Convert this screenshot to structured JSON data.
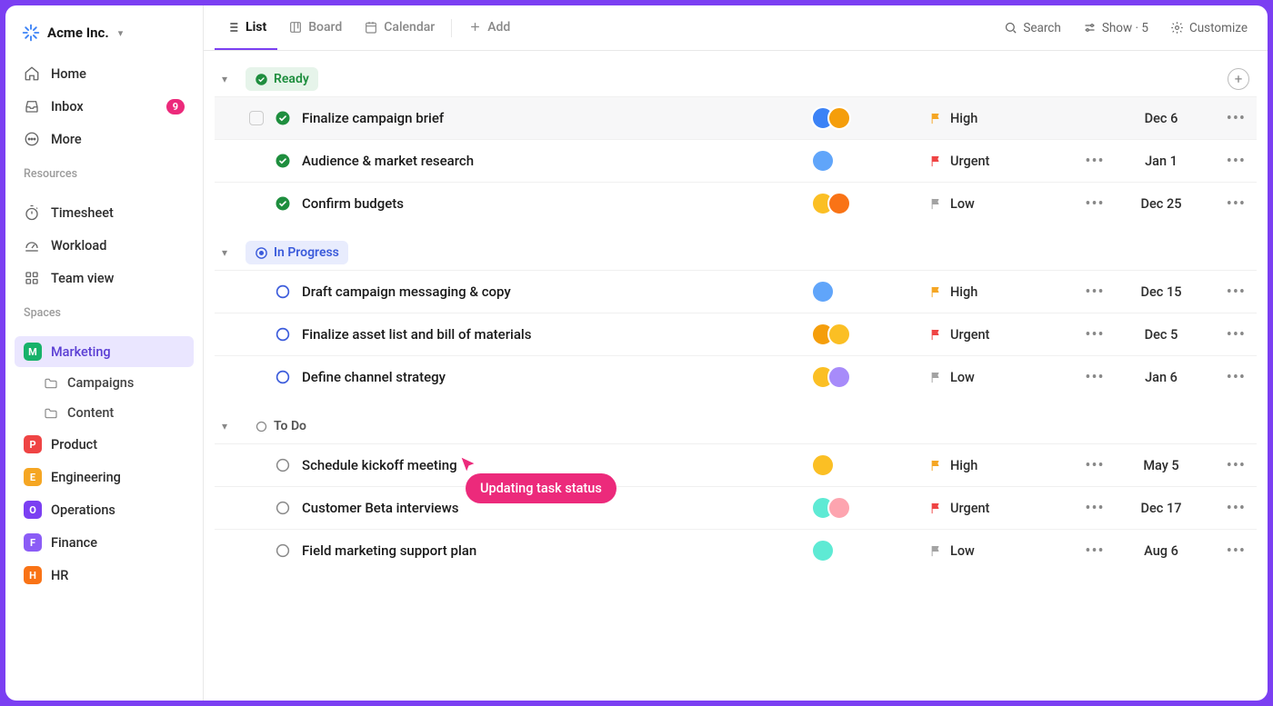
{
  "workspace": {
    "name": "Acme Inc."
  },
  "nav": {
    "home": "Home",
    "inbox": "Inbox",
    "inbox_count": "9",
    "more": "More"
  },
  "resources_label": "Resources",
  "resources": {
    "timesheet": "Timesheet",
    "workload": "Workload",
    "teamview": "Team view"
  },
  "spaces_label": "Spaces",
  "spaces": [
    {
      "letter": "M",
      "label": "Marketing",
      "color": "#17b26a",
      "active": true
    },
    {
      "letter": "P",
      "label": "Product",
      "color": "#ef4444"
    },
    {
      "letter": "E",
      "label": "Engineering",
      "color": "#f5a623"
    },
    {
      "letter": "O",
      "label": "Operations",
      "color": "#7b3ff2"
    },
    {
      "letter": "F",
      "label": "Finance",
      "color": "#8b5cf6"
    },
    {
      "letter": "H",
      "label": "HR",
      "color": "#f97316"
    }
  ],
  "folders": [
    "Campaigns",
    "Content"
  ],
  "tabs": {
    "list": "List",
    "board": "Board",
    "calendar": "Calendar",
    "add": "Add"
  },
  "toolbar": {
    "search": "Search",
    "show": "Show · 5",
    "customize": "Customize"
  },
  "tooltip": "Updating task status",
  "groups": [
    {
      "id": "ready",
      "label": "Ready",
      "add": true,
      "tasks": [
        {
          "name": "Finalize campaign brief",
          "status": "done",
          "assignees": [
            {
              "c": "#3b82f6"
            },
            {
              "c": "#f59e0b"
            }
          ],
          "prio": "High",
          "prio_c": "#f5a623",
          "date": "Dec 6",
          "sub": false,
          "hover": true,
          "check": true
        },
        {
          "name": "Audience & market research",
          "status": "done",
          "assignees": [
            {
              "c": "#60a5fa"
            }
          ],
          "prio": "Urgent",
          "prio_c": "#ef4444",
          "date": "Jan 1",
          "sub": true
        },
        {
          "name": "Confirm budgets",
          "status": "done",
          "assignees": [
            {
              "c": "#fbbf24"
            },
            {
              "c": "#f97316"
            }
          ],
          "prio": "Low",
          "prio_c": "#a3a3a3",
          "date": "Dec 25",
          "sub": true
        }
      ]
    },
    {
      "id": "inprog",
      "label": "In Progress",
      "tasks": [
        {
          "name": "Draft campaign messaging & copy",
          "status": "open-blue",
          "assignees": [
            {
              "c": "#60a5fa"
            }
          ],
          "prio": "High",
          "prio_c": "#f5a623",
          "date": "Dec 15",
          "sub": true
        },
        {
          "name": "Finalize asset list and bill of materials",
          "status": "open-blue",
          "assignees": [
            {
              "c": "#f59e0b"
            },
            {
              "c": "#fbbf24"
            }
          ],
          "prio": "Urgent",
          "prio_c": "#ef4444",
          "date": "Dec 5",
          "sub": true
        },
        {
          "name": "Define channel strategy",
          "status": "open-blue",
          "assignees": [
            {
              "c": "#fbbf24"
            },
            {
              "c": "#a78bfa"
            }
          ],
          "prio": "Low",
          "prio_c": "#a3a3a3",
          "date": "Jan 6",
          "sub": true
        }
      ]
    },
    {
      "id": "todo",
      "label": "To Do",
      "tasks": [
        {
          "name": "Schedule kickoff meeting",
          "status": "open",
          "assignees": [
            {
              "c": "#fbbf24"
            }
          ],
          "prio": "High",
          "prio_c": "#f5a623",
          "date": "May 5",
          "sub": true
        },
        {
          "name": "Customer Beta interviews",
          "status": "open",
          "assignees": [
            {
              "c": "#5eead4"
            },
            {
              "c": "#fda4af"
            }
          ],
          "prio": "Urgent",
          "prio_c": "#ef4444",
          "date": "Dec 17",
          "sub": true
        },
        {
          "name": "Field marketing support plan",
          "status": "open",
          "assignees": [
            {
              "c": "#5eead4"
            }
          ],
          "prio": "Low",
          "prio_c": "#a3a3a3",
          "date": "Aug 6",
          "sub": true
        }
      ]
    }
  ]
}
